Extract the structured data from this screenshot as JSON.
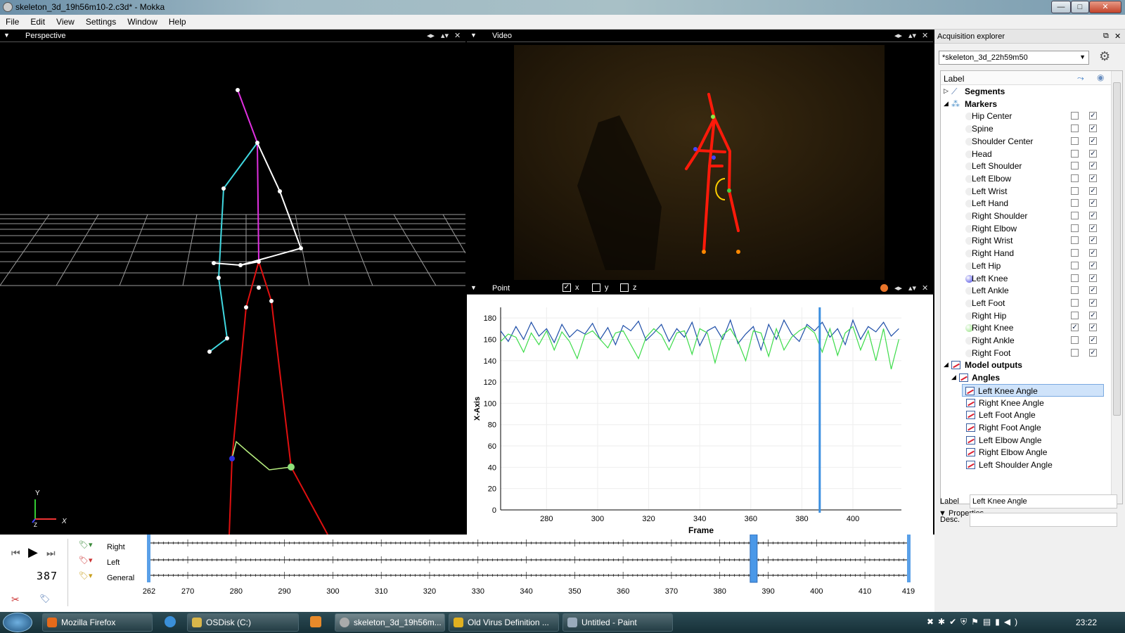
{
  "window": {
    "title": "skeleton_3d_19h56m10-2.c3d* - Mokka",
    "minimize": "—",
    "maximize": "□",
    "close": "✕"
  },
  "menu": [
    "File",
    "Edit",
    "View",
    "Settings",
    "Window",
    "Help"
  ],
  "perspective": {
    "title": "Perspective",
    "axis_y": "Y",
    "axis_x": "X",
    "axis_z": "Z"
  },
  "video": {
    "title": "Video"
  },
  "point": {
    "title": "Point",
    "checks": [
      {
        "label": "x",
        "checked": true
      },
      {
        "label": "y",
        "checked": false
      },
      {
        "label": "z",
        "checked": false
      }
    ],
    "accent": "#e8742a"
  },
  "chart_data": {
    "type": "line",
    "xlabel": "Frame",
    "ylabel": "X-Axis",
    "xlim": [
      262,
      419
    ],
    "ylim": [
      0,
      190
    ],
    "xticks": [
      280,
      300,
      320,
      340,
      360,
      380,
      400
    ],
    "yticks": [
      0,
      20,
      40,
      60,
      80,
      100,
      120,
      140,
      160,
      180
    ],
    "cursor_frame": 387,
    "grid": true,
    "series": [
      {
        "color": "#1e4ea8",
        "x": [
          262,
          265,
          268,
          271,
          274,
          277,
          280,
          283,
          286,
          289,
          292,
          295,
          298,
          301,
          304,
          307,
          310,
          313,
          316,
          319,
          322,
          325,
          328,
          331,
          334,
          337,
          340,
          343,
          346,
          349,
          352,
          355,
          358,
          361,
          364,
          367,
          370,
          373,
          376,
          379,
          382,
          385,
          388,
          391,
          394,
          397,
          400,
          403,
          406,
          409,
          412,
          415,
          418
        ],
        "values": [
          168,
          158,
          172,
          160,
          176,
          163,
          170,
          157,
          174,
          162,
          169,
          165,
          175,
          160,
          171,
          155,
          173,
          168,
          177,
          159,
          166,
          174,
          158,
          170,
          162,
          176,
          154,
          168,
          172,
          160,
          178,
          156,
          165,
          172,
          150,
          174,
          160,
          178,
          165,
          158,
          174,
          168,
          176,
          162,
          170,
          155,
          178,
          160,
          172,
          167,
          176,
          163,
          170
        ]
      },
      {
        "color": "#3ddc4a",
        "x": [
          262,
          265,
          268,
          271,
          274,
          277,
          280,
          283,
          286,
          289,
          292,
          295,
          298,
          301,
          304,
          307,
          310,
          313,
          316,
          319,
          322,
          325,
          328,
          331,
          334,
          337,
          340,
          343,
          346,
          349,
          352,
          355,
          358,
          361,
          364,
          367,
          370,
          373,
          376,
          379,
          382,
          385,
          388,
          391,
          394,
          397,
          400,
          403,
          406,
          409,
          412,
          415,
          418
        ],
        "values": [
          158,
          165,
          162,
          148,
          166,
          155,
          168,
          150,
          167,
          158,
          142,
          164,
          168,
          160,
          152,
          166,
          168,
          155,
          142,
          162,
          170,
          164,
          150,
          166,
          168,
          146,
          170,
          166,
          138,
          164,
          170,
          158,
          140,
          168,
          166,
          144,
          170,
          150,
          162,
          168,
          172,
          166,
          148,
          170,
          145,
          166,
          172,
          150,
          168,
          140,
          170,
          132,
          160
        ]
      }
    ]
  },
  "explorer": {
    "title": "Acquisition explorer",
    "acquisition": "*skeleton_3d_22h59m50",
    "column_label": "Label",
    "segments": "Segments",
    "markers_title": "Markers",
    "markers": [
      {
        "label": "Hip Center",
        "checked": false,
        "visible": true,
        "dot": ""
      },
      {
        "label": "Spine",
        "checked": false,
        "visible": true,
        "dot": ""
      },
      {
        "label": "Shoulder Center",
        "checked": false,
        "visible": true,
        "dot": ""
      },
      {
        "label": "Head",
        "checked": false,
        "visible": true,
        "dot": ""
      },
      {
        "label": "Left Shoulder",
        "checked": false,
        "visible": true,
        "dot": ""
      },
      {
        "label": "Left Elbow",
        "checked": false,
        "visible": true,
        "dot": ""
      },
      {
        "label": "Left Wrist",
        "checked": false,
        "visible": true,
        "dot": ""
      },
      {
        "label": "Left Hand",
        "checked": false,
        "visible": true,
        "dot": ""
      },
      {
        "label": "Right Shoulder",
        "checked": false,
        "visible": true,
        "dot": ""
      },
      {
        "label": "Right Elbow",
        "checked": false,
        "visible": true,
        "dot": ""
      },
      {
        "label": "Right Wrist",
        "checked": false,
        "visible": true,
        "dot": ""
      },
      {
        "label": "Right Hand",
        "checked": false,
        "visible": true,
        "dot": ""
      },
      {
        "label": "Left Hip",
        "checked": false,
        "visible": true,
        "dot": ""
      },
      {
        "label": "Left Knee",
        "checked": false,
        "visible": true,
        "dot": "#3a3ae0"
      },
      {
        "label": "Left Ankle",
        "checked": false,
        "visible": true,
        "dot": ""
      },
      {
        "label": "Left Foot",
        "checked": false,
        "visible": true,
        "dot": ""
      },
      {
        "label": "Right Hip",
        "checked": false,
        "visible": true,
        "dot": ""
      },
      {
        "label": "Right Knee",
        "checked": true,
        "visible": true,
        "dot": "#8fe07a"
      },
      {
        "label": "Right Ankle",
        "checked": false,
        "visible": true,
        "dot": ""
      },
      {
        "label": "Right Foot",
        "checked": false,
        "visible": true,
        "dot": ""
      }
    ],
    "model_outputs": "Model outputs",
    "angles_title": "Angles",
    "angles": [
      "Left Knee Angle",
      "Right Knee Angle",
      "Left Foot Angle",
      "Right Foot Angle",
      "Left Elbow Angle",
      "Right Elbow Angle",
      "Left Shoulder Angle"
    ],
    "properties_title": "Properties",
    "prop_label": "Label",
    "prop_label_value": "Left Knee Angle",
    "prop_desc": "Desc.",
    "prop_desc_value": ""
  },
  "timeline": {
    "current_frame": "387",
    "tracks": [
      "Right",
      "Left",
      "General"
    ],
    "first": 262,
    "last": 419,
    "labels": [
      "262",
      "270",
      "280",
      "290",
      "300",
      "310",
      "320",
      "330",
      "340",
      "350",
      "360",
      "370",
      "380",
      "390",
      "400",
      "410",
      "419"
    ],
    "cursor": 387
  },
  "taskbar": {
    "items": [
      "Mozilla Firefox",
      "OSDisk (C:)",
      "skeleton_3d_19h56m...",
      "Old Virus Definition ...",
      "Untitled - Paint"
    ],
    "clock": "23:22"
  }
}
